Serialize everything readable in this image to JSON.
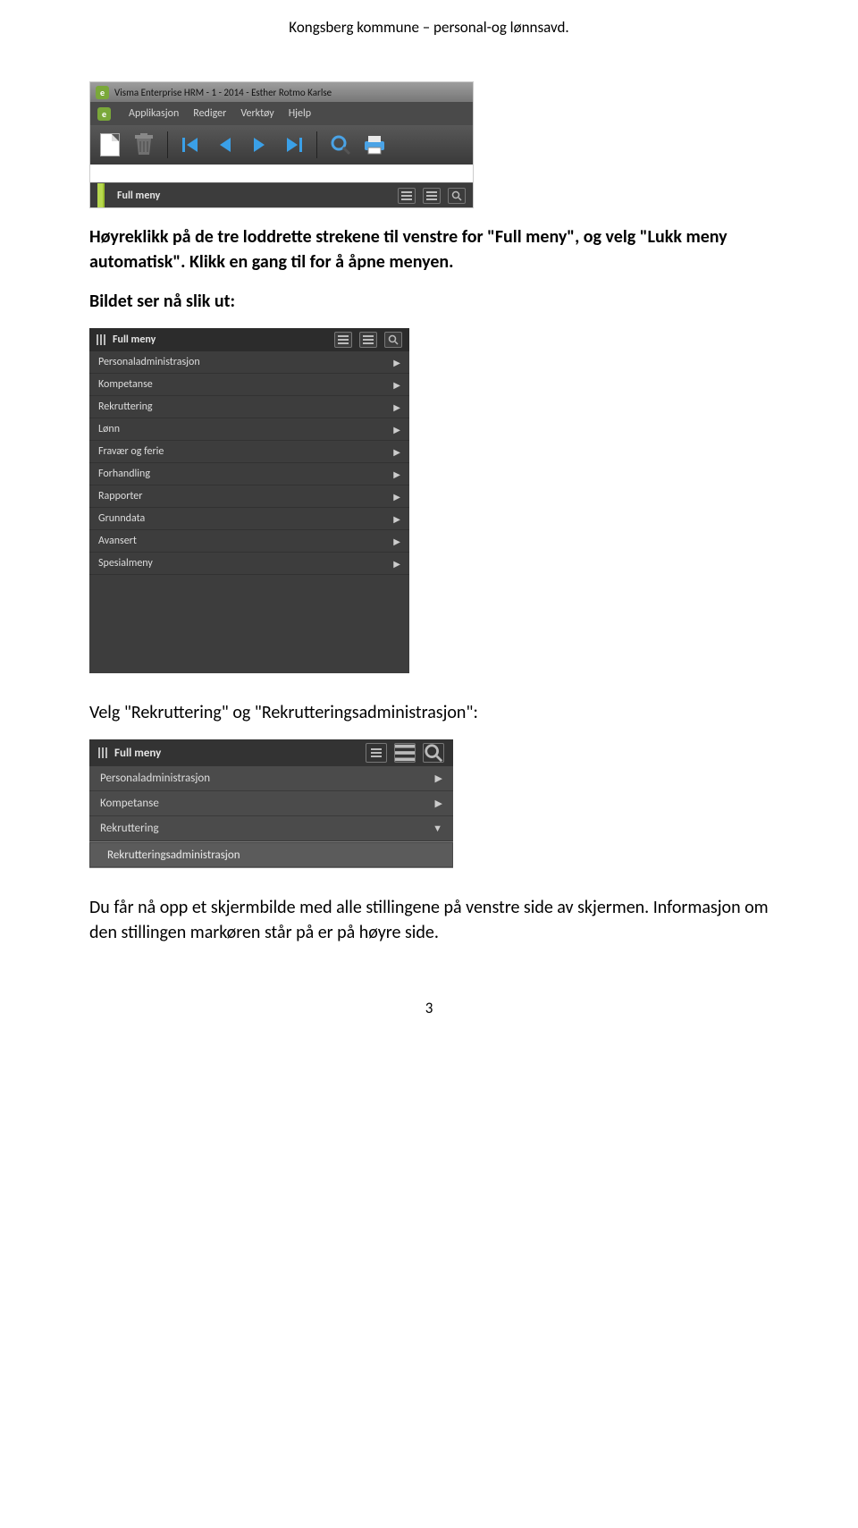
{
  "header": {
    "text": "Kongsberg kommune – personal-og lønnsavd."
  },
  "paragraphs": {
    "p1a": "Høyreklikk på de tre loddrette strekene til venstre for \"Full meny\", og velg \"Lukk meny automatisk\". Klikk en gang til for å åpne menyen.",
    "p1b": "Bildet ser nå slik ut:",
    "p2": "Velg \"Rekruttering\" og \"Rekrutteringsadministrasjon\":",
    "p3": "Du får nå opp et skjermbilde med alle stillingene på venstre side av skjermen. Informasjon om den stillingen markøren står på er på høyre side."
  },
  "page_number": "3",
  "shot1": {
    "title": "Visma Enterprise HRM - 1 - 2014 - Esther Rotmo Karlse",
    "menus": [
      "Applikasjon",
      "Rediger",
      "Verktøy",
      "Hjelp"
    ],
    "fullmeny_label": "Full meny"
  },
  "shot2": {
    "fullmeny_label": "Full meny",
    "items": [
      "Personaladministrasjon",
      "Kompetanse",
      "Rekruttering",
      "Lønn",
      "Fravær og ferie",
      "Forhandling",
      "Rapporter",
      "Grunndata",
      "Avansert",
      "Spesialmeny"
    ]
  },
  "shot3": {
    "fullmeny_label": "Full meny",
    "items": [
      {
        "label": "Personaladministrasjon",
        "expanded": false
      },
      {
        "label": "Kompetanse",
        "expanded": false
      },
      {
        "label": "Rekruttering",
        "expanded": true,
        "sub": "Rekrutteringsadministrasjon"
      }
    ]
  }
}
